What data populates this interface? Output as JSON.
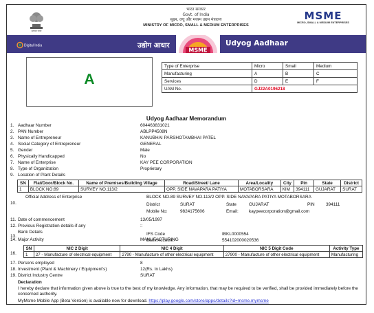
{
  "header": {
    "ministry_hindi_1": "भारत सरकार",
    "ministry_hindi_2": "Govt. of India",
    "ministry_hindi_3": "सूक्ष्म, लघु और मध्यम उद्यम मंत्रालय",
    "ministry_en": "MINISTRY OF MICRO, SMALL & MEDIUM ENTERPRISES",
    "msme_logo": "MSME",
    "msme_sub": "MICRO, SMALL & MEDIUM ENTERPRISES"
  },
  "banner": {
    "digital_india": "Digital India",
    "udyog_aadhaar_hindi": "उद्योग आधार",
    "badge": "MSME",
    "udyog_aadhaar_en": "Udyog Aadhaar",
    "bg_color": "#3f3a85"
  },
  "category_letter": "A",
  "enterprise_table": {
    "header": [
      "Type of Enterprise",
      "Micro",
      "Small",
      "Medium"
    ],
    "rows": [
      [
        "Manufacturing",
        "A",
        "B",
        "C"
      ],
      [
        "Services",
        "D",
        "E",
        "F"
      ]
    ],
    "uam_label": "UAM No.",
    "uam_value": "GJ22A0196218"
  },
  "memorandum_title": "Udyog Aadhaar Memorandum",
  "fields": [
    {
      "num": "1.",
      "label": "Aadhaar Number",
      "value": "604463831021"
    },
    {
      "num": "2.",
      "label": "PAN Number",
      "value": "ABLPP4508N"
    },
    {
      "num": "3.",
      "label": "Name of Entrepreneur",
      "value": "KANUBHAI PARSHOTAMBHAI PATEL"
    },
    {
      "num": "4.",
      "label": "Social Category of Entrepreneur",
      "value": "GENERAL"
    },
    {
      "num": "5.",
      "label": "Gender",
      "value": "Male"
    },
    {
      "num": "6.",
      "label": "Physically Handicapped",
      "value": "No"
    },
    {
      "num": "7.",
      "label": "Name of Enterprise",
      "value": "KAY PEE CORPORATION"
    },
    {
      "num": "8.",
      "label": "Type of Organization",
      "value": "Proprietary"
    },
    {
      "num": "9.",
      "label": "Location of Plant Details",
      "value": ""
    }
  ],
  "plant_table": {
    "headers": [
      "SN",
      "Flat/Door/Block No.",
      "Name of Premises/Building Village",
      "Road/Street/ Lane",
      "Area/Locality",
      "City",
      "Pin",
      "State",
      "District"
    ],
    "rows": [
      [
        "1",
        "BLOCK NO:89",
        "SURVEY NO.113/2",
        "OPP. SIDE NAVAPARA PATIYA",
        "MOTABORSARA",
        "KIM",
        "394111",
        "GUJARAT",
        "SURAT"
      ]
    ]
  },
  "office": {
    "num": "10.",
    "label": "Official Address of Enterprise",
    "address": "BLOCK NO.89 SURVEY NO.113/2 OPP. SIDE NAVAPARA PATIYA MOTABORSARA",
    "district_label": "District",
    "district": "SURAT",
    "state_label": "State",
    "state": "GUJARAT",
    "pin_label": "PIN",
    "pin": "394111",
    "mobile_label": "Mobile No:",
    "mobile": "9824175606",
    "email_label": "Email:",
    "email": "kaypeecorporation@gmail.com"
  },
  "commencement": {
    "num": "11.",
    "label": "Date of commencement",
    "value": "13/05/1997"
  },
  "previous": {
    "num": "12.",
    "label": "Previous Registration details-if any",
    "value": "::"
  },
  "bank": {
    "num": "13.",
    "label": "Bank Details",
    "ifs_label": "IFS Code",
    "ifs": "IBKL0000554",
    "account_label": "Bank Account:",
    "account": "554102000020536"
  },
  "major_activity": {
    "num": "14.",
    "label": "Major Activity",
    "value": "MANUFACTURING"
  },
  "nic_table": {
    "num": "16.",
    "headers": [
      "SN",
      "NIC 2 Digit",
      "NIC 4 Digit",
      "NIC 5 Digit Code",
      "Activity Type"
    ],
    "rows": [
      [
        "1",
        "27 - Manufacture of electrical equipment",
        "2790 - Manufacture of other electrical equipment",
        "27900 - Manufacture of other electrical equipment",
        "Manufacturing"
      ]
    ]
  },
  "persons": {
    "num": "17.",
    "label": "Persons employed",
    "value": "8"
  },
  "investment": {
    "num": "18.",
    "label": "Investment (Plant & Machinery / Equipment's)",
    "value": "12(Rs. In Lakhs)"
  },
  "dic": {
    "num": "19.",
    "label": "District Industry Centre",
    "value": "SURAT"
  },
  "declaration": {
    "heading": "Declaration",
    "text": "I hereby declare that information given above is true to the best of my knowledge. Any information, that may be required to be verified, shall be provided immediately before the concerned authority."
  },
  "app_note": {
    "text": "MyMsme Mobile App (Beta Version) is available now for download.",
    "link": "https://play.google.com/store/apps/details?id=msme.mymsme"
  }
}
